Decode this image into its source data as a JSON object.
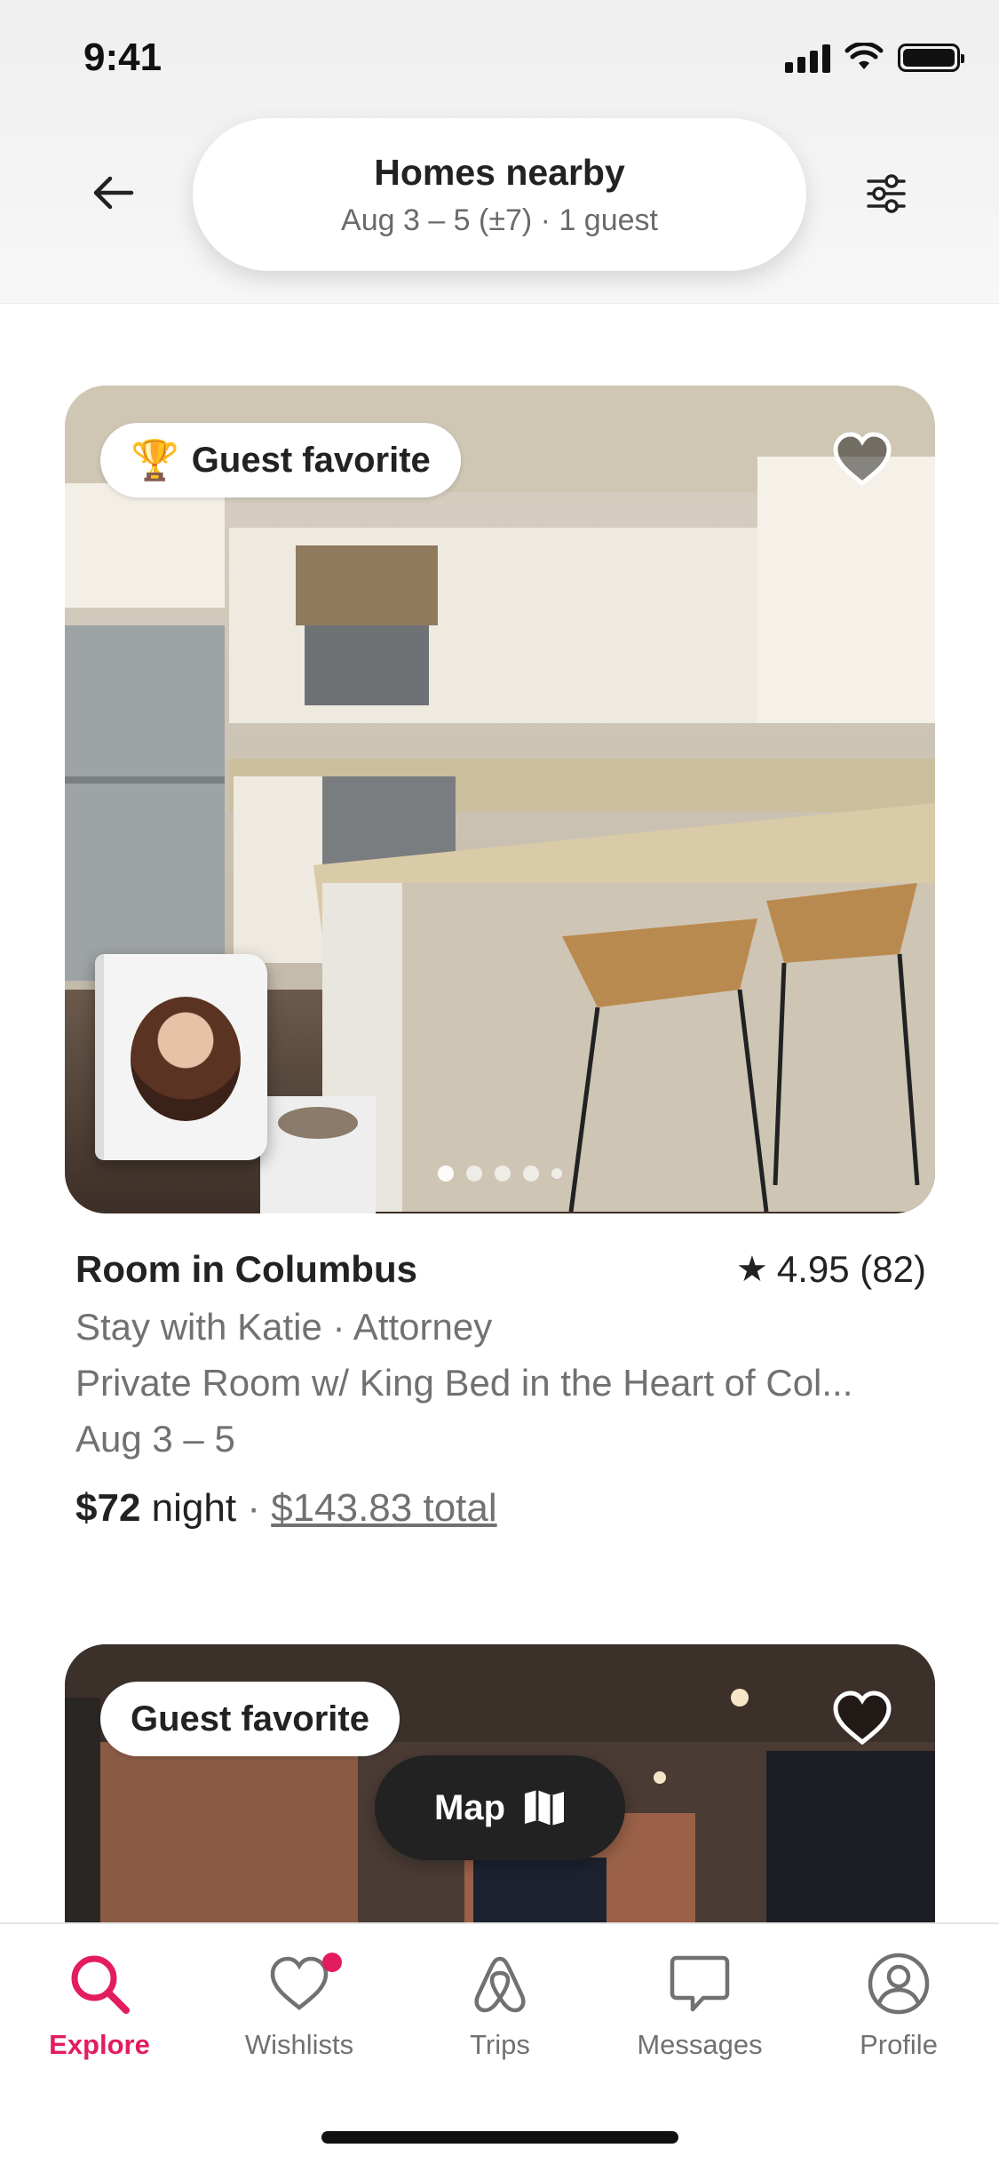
{
  "status_bar": {
    "time": "9:41"
  },
  "header": {
    "title": "Homes nearby",
    "subtitle": "Aug 3 – 5 (±7) · 1 guest"
  },
  "listings": [
    {
      "badge": "Guest favorite",
      "title": "Room in Columbus",
      "rating": "4.95 (82)",
      "host_line": "Stay with Katie · Attorney",
      "description": "Private Room w/ King Bed in the Heart of Col...",
      "dates": "Aug 3 – 5",
      "price": "$72",
      "price_unit": "night",
      "separator": "·",
      "total": "$143.83 total"
    },
    {
      "badge": "Guest favorite"
    }
  ],
  "map_button": {
    "label": "Map"
  },
  "tabs": [
    {
      "label": "Explore",
      "icon": "search-icon",
      "active": true
    },
    {
      "label": "Wishlists",
      "icon": "heart-icon",
      "badge": true
    },
    {
      "label": "Trips",
      "icon": "airbnb-logo-icon"
    },
    {
      "label": "Messages",
      "icon": "message-icon"
    },
    {
      "label": "Profile",
      "icon": "profile-icon"
    }
  ],
  "colors": {
    "accent": "#e31c5f",
    "text": "#222222",
    "secondary_text": "#717171",
    "map_button": "#222222"
  }
}
